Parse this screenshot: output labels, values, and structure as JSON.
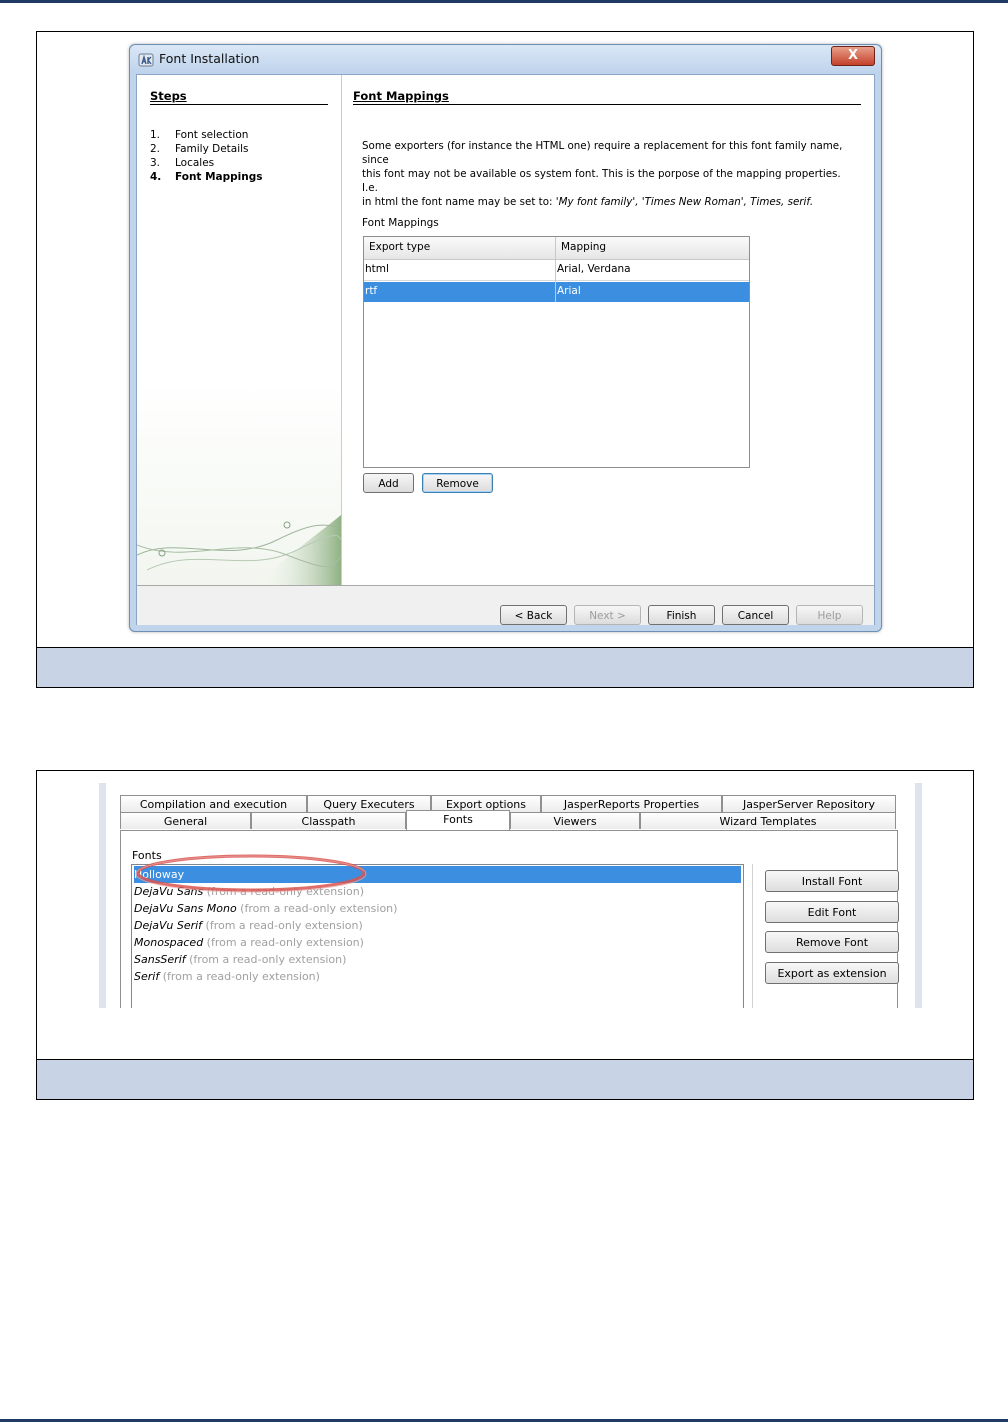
{
  "figure1": {
    "window_title": "Font Installation",
    "close_glyph": "X",
    "steps_heading": "Steps",
    "steps": [
      {
        "num": "1.",
        "label": "Font selection",
        "active": false
      },
      {
        "num": "2.",
        "label": "Family Details",
        "active": false
      },
      {
        "num": "3.",
        "label": "Locales",
        "active": false
      },
      {
        "num": "4.",
        "label": "Font Mappings",
        "active": true
      }
    ],
    "content_heading": "Font Mappings",
    "description_line1": "Some exporters (for instance the HTML one) require a replacement for this font family name, since",
    "description_line2": "this font may not be available os system font. This is the porpose of the mapping properties. I.e.",
    "description_line3_prefix": "in html the font name may be set to: ",
    "description_line3_italic": "'My font family', 'Times New Roman', Times, serif.",
    "mappings_label": "Font Mappings",
    "table": {
      "headers": [
        "Export type",
        "Mapping"
      ],
      "rows": [
        {
          "export_type": "html",
          "mapping": "Arial, Verdana",
          "selected": false
        },
        {
          "export_type": "rtf",
          "mapping": "Arial",
          "selected": true
        }
      ]
    },
    "buttons": {
      "add": "Add",
      "remove": "Remove"
    },
    "footer_buttons": {
      "back": "< Back",
      "next": "Next >",
      "finish": "Finish",
      "cancel": "Cancel",
      "help": "Help"
    }
  },
  "figure2": {
    "tabs_row1": [
      "Compilation and execution",
      "Query Executers",
      "Export options",
      "JasperReports Properties",
      "JasperServer Repository"
    ],
    "tabs_row2": [
      "General",
      "Classpath",
      "Fonts",
      "Viewers",
      "Wizard Templates"
    ],
    "active_tab": "Fonts",
    "fonts_label": "Fonts",
    "fonts": [
      {
        "name": "Holloway",
        "suffix": "",
        "selected": true
      },
      {
        "name": "DejaVu Sans",
        "suffix": " (from a read-only extension)",
        "selected": false
      },
      {
        "name": "DejaVu Sans Mono",
        "suffix": " (from a read-only extension)",
        "selected": false
      },
      {
        "name": "DejaVu Serif",
        "suffix": " (from a read-only extension)",
        "selected": false
      },
      {
        "name": "Monospaced",
        "suffix": " (from a read-only extension)",
        "selected": false
      },
      {
        "name": "SansSerif",
        "suffix": " (from a read-only extension)",
        "selected": false
      },
      {
        "name": "Serif",
        "suffix": " (from a read-only extension)",
        "selected": false
      }
    ],
    "buttons": {
      "install": "Install Font",
      "edit": "Edit Font",
      "remove": "Remove Font",
      "export": "Export as extension"
    }
  },
  "colors": {
    "selection": "#3c8fe0",
    "caption_bar": "#c8d3e5",
    "highlight_ring": "#d9534f"
  }
}
